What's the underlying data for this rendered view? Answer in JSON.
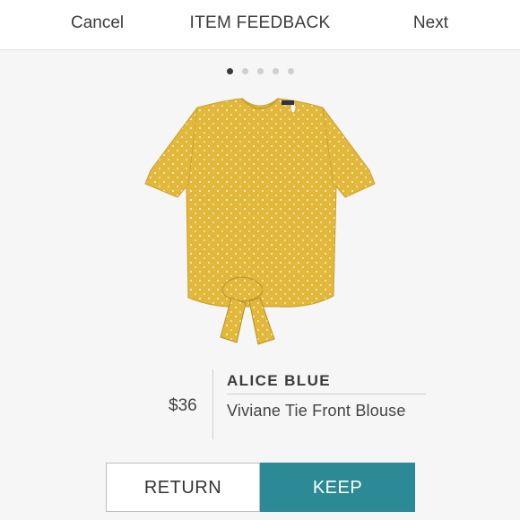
{
  "header": {
    "cancel_label": "Cancel",
    "title": "ITEM FEEDBACK",
    "next_label": "Next"
  },
  "carousel": {
    "total_slides": 5,
    "active_index": 1
  },
  "product": {
    "brand": "ALICE BLUE",
    "name": "Viviane Tie Front Blouse",
    "price": "$36",
    "image_semantic": "yellow-polka-dot-tie-front-blouse"
  },
  "actions": {
    "return_label": "RETURN",
    "keep_label": "KEEP"
  },
  "colors": {
    "keep_button": "#2b8a95",
    "blouse": "#e2b83a",
    "background": "#f6f6f6"
  }
}
